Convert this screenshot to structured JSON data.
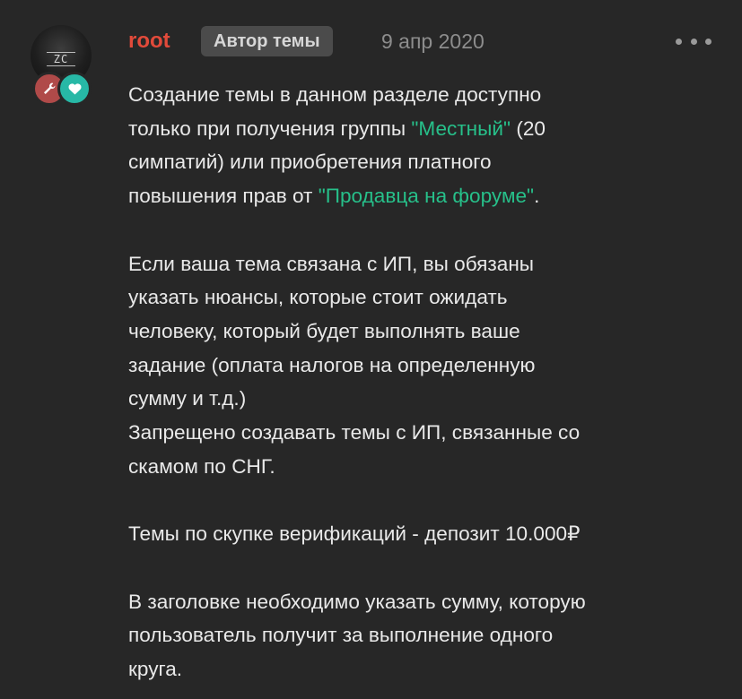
{
  "author": {
    "username": "root",
    "badge_label": "Автор темы",
    "date": "9 апр 2020",
    "avatar_text": "ZC"
  },
  "icons": {
    "avatar": "avatar-image",
    "role_badge_1": "wrench-icon",
    "role_badge_2": "heart-icon",
    "menu": "more-dots-icon"
  },
  "colors": {
    "background": "#272727",
    "username": "#e24a3a",
    "highlight": "#27c08a",
    "badge_bg": "#4b4b4b",
    "wrench_badge": "#b04a49",
    "heart_badge": "#27b8a6",
    "text": "#e9e9e9",
    "date": "#8d8d8d"
  },
  "content": {
    "p1_a": "Создание темы в данном разделе доступно",
    "p1_b": "только при получения группы ",
    "p1_hl1": "\"Местный\"",
    "p1_c": " (20",
    "p1_d": "симпатий) или приобретения платного",
    "p1_e": "повышения прав от ",
    "p1_hl2": "\"Продавца на форуме\"",
    "p1_f": ".",
    "p2_a": "Если ваша тема связана с ИП, вы обязаны",
    "p2_b": "указать нюансы, которые стоит ожидать",
    "p2_c": "человеку, который будет выполнять ваше",
    "p2_d": "задание (оплата налогов на определенную",
    "p2_e": "сумму и т.д.)",
    "p2_f": "Запрещено создавать темы с ИП, связанные со",
    "p2_g": "скамом по СНГ.",
    "p3": "Темы по скупке верификаций - депозит 10.000₽",
    "p4_a": "В заголовке необходимо указать сумму, которую",
    "p4_b": "пользователь получит за выполнение одного",
    "p4_c": "круга."
  }
}
